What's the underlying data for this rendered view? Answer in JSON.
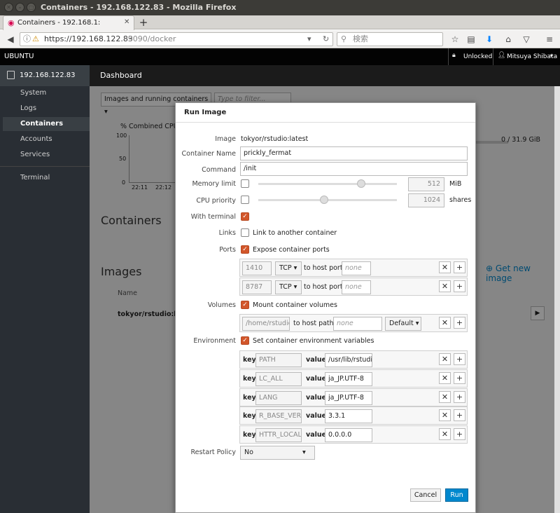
{
  "window": {
    "title": "Containers - 192.168.122.83 - Mozilla Firefox"
  },
  "browser": {
    "tab_title": "Containers - 192.168.1:",
    "url_host": "https://192.168.122.83",
    "url_path": ":9090/docker",
    "search_placeholder": "検索",
    "new_tab": "+"
  },
  "cockpit": {
    "os_name": "UBUNTU",
    "lock_status": "Unlocked",
    "user": "Mitsuya Shibata",
    "host": "192.168.122.83",
    "sidebar": [
      "System",
      "Logs",
      "Containers",
      "Accounts",
      "Services",
      "Terminal"
    ],
    "active_item": "Containers",
    "page_title": "Dashboard",
    "filter_dropdown": "Images and running containers",
    "filter_placeholder": "Type to filter...",
    "chart_title": "Combined CPU u",
    "chart_unit": "%",
    "chart_ticks": [
      "100",
      "50",
      "0"
    ],
    "chart_times": [
      "22:11",
      "22:12"
    ],
    "memory_usage": "0 / 31.9 GiB",
    "containers_heading": "Containers",
    "images_heading": "Images",
    "get_new_image": "Get new image",
    "name_column": "Name",
    "image_row": "tokyor/rstudio:late"
  },
  "modal": {
    "title": "Run Image",
    "image_label": "Image",
    "image_value": "tokyor/rstudio:latest",
    "container_name_label": "Container Name",
    "container_name": "prickly_fermat",
    "command_label": "Command",
    "command": "/init",
    "memory_limit_label": "Memory limit",
    "memory_value": "512",
    "memory_unit": "MiB",
    "cpu_priority_label": "CPU priority",
    "cpu_value": "1024",
    "cpu_unit": "shares",
    "with_terminal_label": "With terminal",
    "links_label": "Links",
    "links_checkbox": "Link to another container",
    "ports_label": "Ports",
    "ports_checkbox": "Expose container ports",
    "ports": [
      {
        "container": "1410",
        "protocol": "TCP",
        "to": "to host port",
        "host_placeholder": "none"
      },
      {
        "container": "8787",
        "protocol": "TCP",
        "to": "to host port",
        "host_placeholder": "none"
      }
    ],
    "volumes_label": "Volumes",
    "volumes_checkbox": "Mount container volumes",
    "volume": {
      "container_path": "/home/rstudio",
      "to": "to host path",
      "host_placeholder": "none",
      "mode": "Default"
    },
    "environment_label": "Environment",
    "environment_checkbox": "Set container environment variables",
    "env_key_label": "key",
    "env_value_label": "value",
    "env": [
      {
        "key": "PATH",
        "value": "/usr/lib/rstudio"
      },
      {
        "key": "LC_ALL",
        "value": "ja_JP.UTF-8"
      },
      {
        "key": "LANG",
        "value": "ja_JP.UTF-8"
      },
      {
        "key": "R_BASE_VERSI",
        "value": "3.3.1"
      },
      {
        "key": "HTTR_LOCALH",
        "value": "0.0.0.0"
      }
    ],
    "restart_policy_label": "Restart Policy",
    "restart_policy": "No",
    "cancel": "Cancel",
    "run": "Run"
  }
}
